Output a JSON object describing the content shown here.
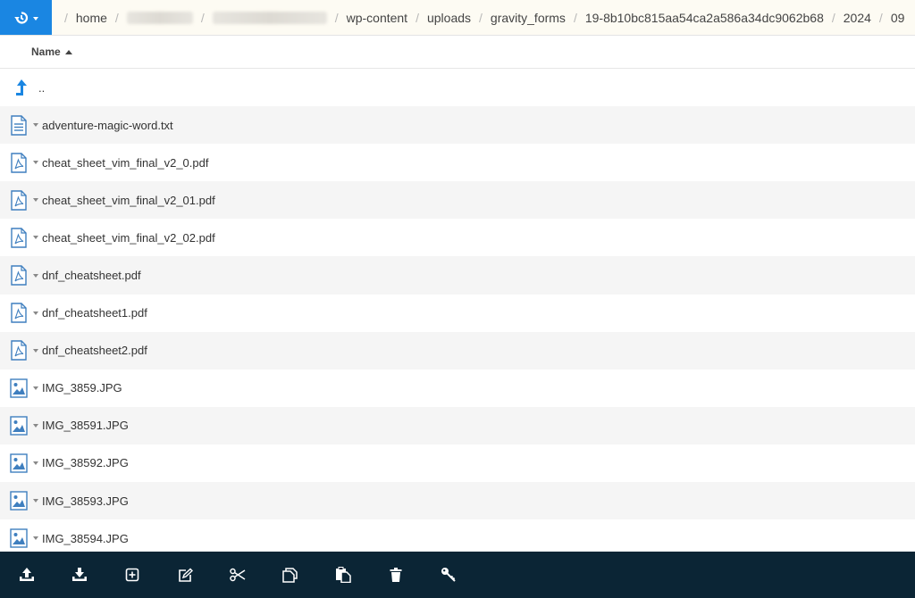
{
  "breadcrumb": {
    "history_icon": "history-icon",
    "segments": [
      "home",
      "",
      "",
      "wp-content",
      "uploads",
      "gravity_forms",
      "19-8b10bc815aa54ca2a586a34dc9062b68",
      "2024",
      "09"
    ]
  },
  "column_header": {
    "name_label": "Name",
    "sort": "ascending"
  },
  "files": [
    {
      "name": "..",
      "type": "parent"
    },
    {
      "name": "adventure-magic-word.txt",
      "type": "text"
    },
    {
      "name": "cheat_sheet_vim_final_v2_0.pdf",
      "type": "pdf"
    },
    {
      "name": "cheat_sheet_vim_final_v2_01.pdf",
      "type": "pdf"
    },
    {
      "name": "cheat_sheet_vim_final_v2_02.pdf",
      "type": "pdf"
    },
    {
      "name": "dnf_cheatsheet.pdf",
      "type": "pdf"
    },
    {
      "name": "dnf_cheatsheet1.pdf",
      "type": "pdf"
    },
    {
      "name": "dnf_cheatsheet2.pdf",
      "type": "pdf"
    },
    {
      "name": "IMG_3859.JPG",
      "type": "image"
    },
    {
      "name": "IMG_38591.JPG",
      "type": "image"
    },
    {
      "name": "IMG_38592.JPG",
      "type": "image"
    },
    {
      "name": "IMG_38593.JPG",
      "type": "image"
    },
    {
      "name": "IMG_38594.JPG",
      "type": "image"
    }
  ],
  "toolbar": {
    "buttons": [
      "upload-icon",
      "download-icon",
      "new-item-icon",
      "edit-icon",
      "cut-icon",
      "copy-icon",
      "paste-icon",
      "delete-icon",
      "permissions-key-icon"
    ]
  },
  "colors": {
    "accent": "#1a86e2",
    "toolbar_bg": "#0b2535",
    "icon_blue": "#3f7fbf",
    "row_alt": "#f5f5f5"
  }
}
